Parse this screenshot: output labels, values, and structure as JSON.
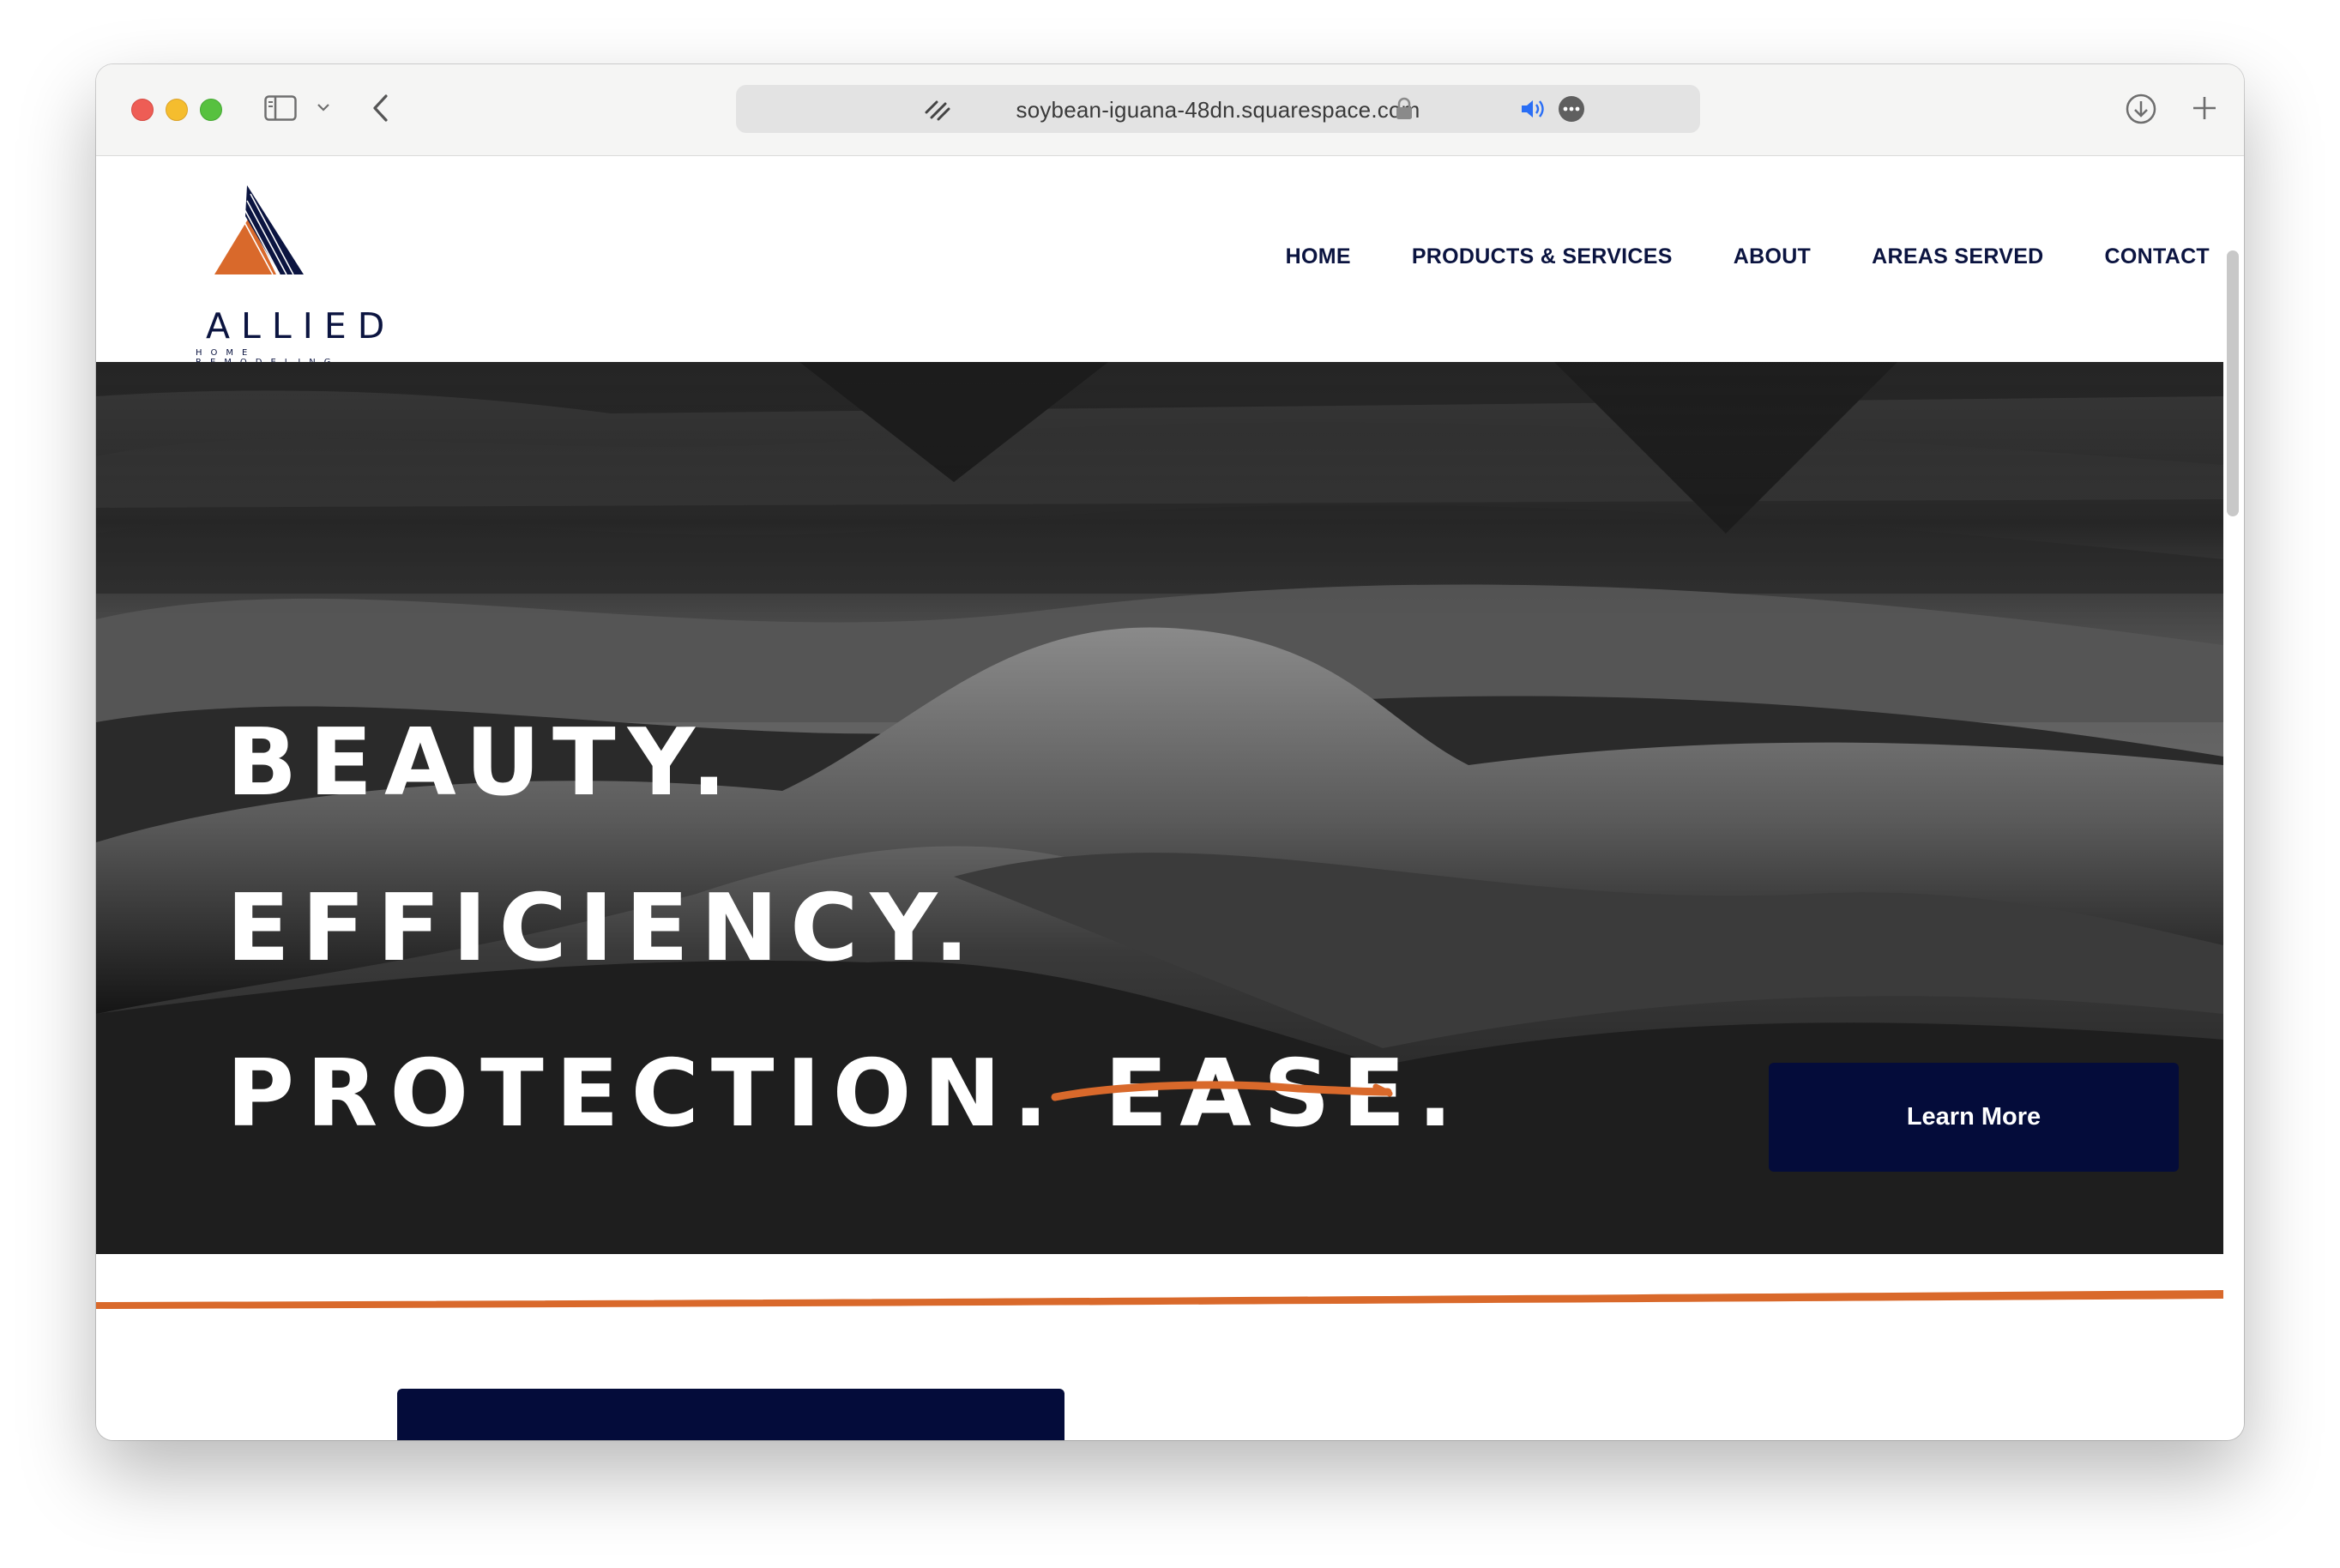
{
  "browser": {
    "url": "soybean-iguana-48dn.squarespace.com",
    "icons": [
      "sidebar-icon",
      "chevron-down-icon",
      "back-icon",
      "squarespace-icon",
      "lock-icon",
      "speaker-icon",
      "more-icon",
      "download-icon",
      "new-tab-icon"
    ]
  },
  "site": {
    "logo": {
      "word": "ALLIED",
      "tagline": "HOME REMODELING",
      "colors": {
        "navy": "#0b1440",
        "orange": "#d9692b"
      }
    },
    "nav": [
      "HOME",
      "PRODUCTS & SERVICES",
      "ABOUT",
      "AREAS SERVED",
      "CONTACT"
    ],
    "hero": {
      "line1": "BEAUTY.",
      "line2": "EFFICIENCY.",
      "line3_prefix": "PROTECTION. ",
      "line3_accent": "EASE",
      "line3_suffix": ".",
      "cta": "Learn More",
      "accent_color": "#d9692b",
      "button_color": "#040c3a"
    }
  }
}
